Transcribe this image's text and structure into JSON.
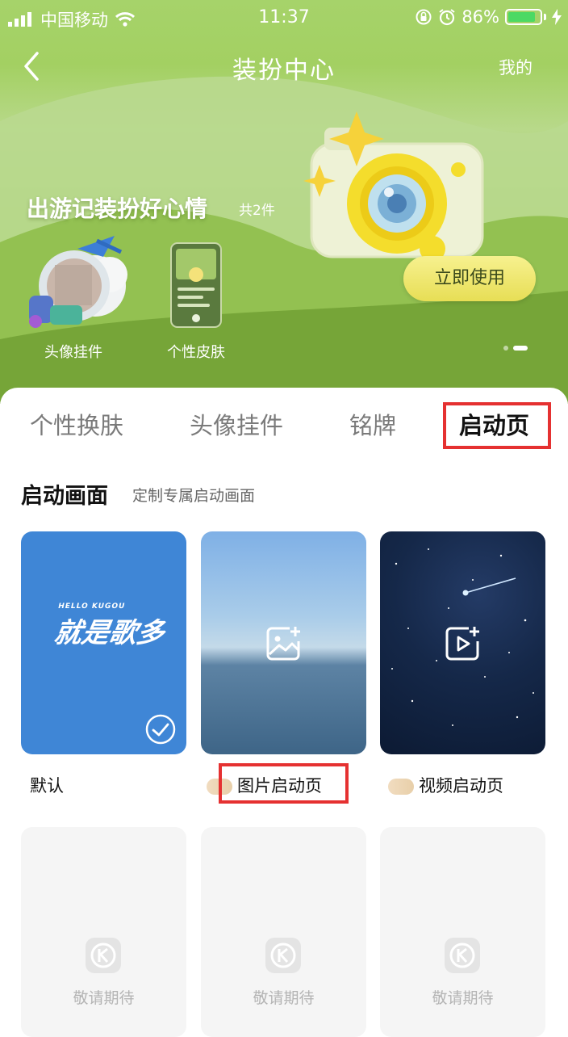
{
  "status_bar": {
    "carrier": "中国移动",
    "time": "11:37",
    "battery_percent": "86%",
    "battery_level": 0.86
  },
  "nav": {
    "title": "装扮中心",
    "mine": "我的"
  },
  "banner": {
    "title": "出游记装扮好心情",
    "count": "共2件",
    "items": [
      {
        "label": "头像挂件"
      },
      {
        "label": "个性皮肤"
      }
    ],
    "cta": "立即使用"
  },
  "tabs": [
    {
      "label": "个性换肤"
    },
    {
      "label": "头像挂件"
    },
    {
      "label": "铭牌"
    },
    {
      "label": "启动页"
    }
  ],
  "section": {
    "title": "启动画面",
    "subtitle": "定制专属启动画面"
  },
  "cards": [
    {
      "label": "默认",
      "image_text": "就是歌多",
      "image_small": "HELLO KUGOU"
    },
    {
      "label": "图片启动页"
    },
    {
      "label": "视频启动页"
    }
  ],
  "placeholders": [
    {
      "label": "敬请期待"
    },
    {
      "label": "敬请期待"
    },
    {
      "label": "敬请期待"
    }
  ],
  "colors": {
    "highlight": "#e53131",
    "default_card": "#3f86d6",
    "cta": "#eee674"
  }
}
